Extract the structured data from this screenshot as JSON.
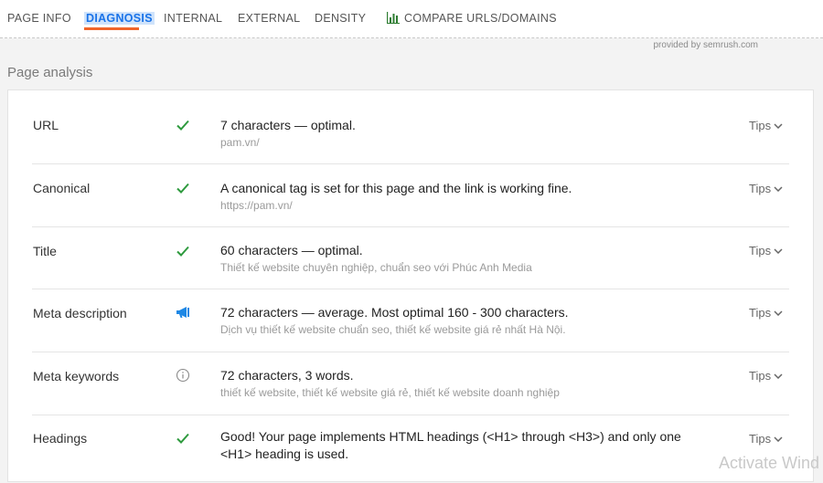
{
  "nav": {
    "tabs": [
      {
        "label": "PAGE INFO"
      },
      {
        "label": "DIAGNOSIS"
      },
      {
        "label": "INTERNAL"
      },
      {
        "label": "EXTERNAL"
      },
      {
        "label": "DENSITY"
      },
      {
        "label": "COMPARE URLS/DOMAINS",
        "icon": "bar-chart-icon"
      }
    ],
    "active_tab": "DIAGNOSIS"
  },
  "provided_by": "provided by  semrush.com",
  "section_title": "Page analysis",
  "colors": {
    "active_tab": "#1a73e8",
    "active_underline": "#f0652b",
    "check": "#2e9a3e",
    "notice": "#1e88e5"
  },
  "rows": [
    {
      "label": "URL",
      "status": "check-icon",
      "main": "7 characters — optimal.",
      "sub": "pam.vn/",
      "tips": "Tips"
    },
    {
      "label": "Canonical",
      "status": "check-icon",
      "main": "A canonical tag is set for this page and the link is working fine.",
      "sub": "https://pam.vn/",
      "tips": "Tips"
    },
    {
      "label": "Title",
      "status": "check-icon",
      "main": "60 characters — optimal.",
      "sub": "Thiết kế website chuyên nghiệp, chuẩn seo với Phúc Anh Media",
      "tips": "Tips"
    },
    {
      "label": "Meta description",
      "status": "megaphone-icon",
      "main": "72 characters — average. Most optimal 160 - 300 characters.",
      "sub": "Dịch vụ thiết kế website chuẩn seo, thiết kế website giá rẻ nhất Hà Nội.",
      "tips": "Tips"
    },
    {
      "label": "Meta keywords",
      "status": "info-icon",
      "main": "72 characters, 3 words.",
      "sub": "thiết kế website, thiết kế website giá rẻ, thiết kế website doanh nghiệp",
      "tips": "Tips"
    },
    {
      "label": "Headings",
      "status": "check-icon",
      "main": "Good! Your page implements HTML headings (<H1> through <H3>) and only one <H1> heading is used.",
      "sub": "",
      "tips": "Tips"
    }
  ],
  "watermark": "Activate Wind"
}
